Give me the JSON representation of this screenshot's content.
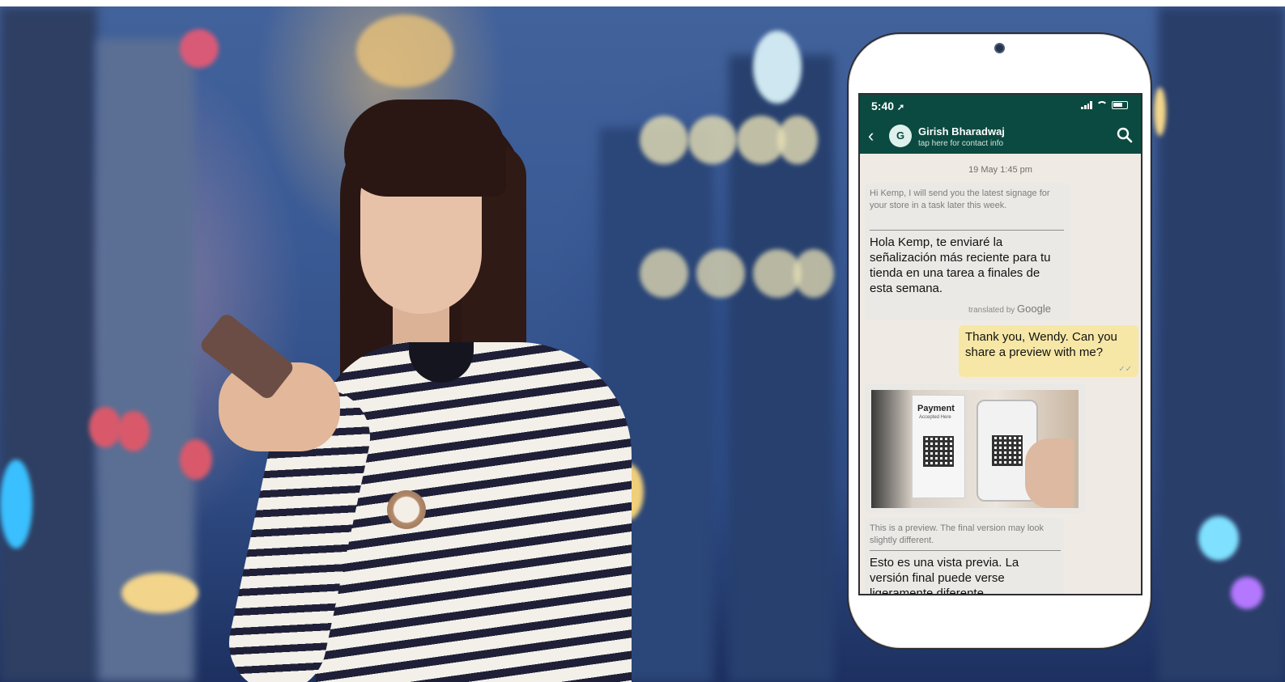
{
  "status_bar": {
    "time": "5:40"
  },
  "contact": {
    "avatar_initial": "G",
    "name": "Girish Bharadwaj",
    "subtitle": "tap here for contact info"
  },
  "chat": {
    "date_label": "19 May 1:45 pm",
    "messages": [
      {
        "direction": "incoming",
        "original_text": "Hi Kemp, I will send you the latest signage for your store in a task later this week.",
        "translated_text": "Hola Kemp, te enviaré la señalización más reciente para tu tienda en una tarea a finales de esta semana.",
        "translation_credit": "translated by",
        "translation_brand": "Google"
      },
      {
        "direction": "outgoing",
        "text": "Thank you, Wendy. Can you share a preview with me?",
        "status_icon": "double-check-icon"
      },
      {
        "direction": "incoming",
        "type": "image",
        "image_text": {
          "title": "Payment",
          "subtitle": "Accepted Here"
        }
      },
      {
        "direction": "incoming",
        "original_text": "This is a preview. The final version may look slightly different.",
        "translated_text": "Esto es una vista previa. La versión final puede verse ligeramente diferente."
      }
    ]
  },
  "colors": {
    "header": "#0b4a40",
    "outgoing_bubble": "#f7e7a6",
    "incoming_bubble": "#ebe9e6",
    "chat_background": "#efebe4"
  }
}
